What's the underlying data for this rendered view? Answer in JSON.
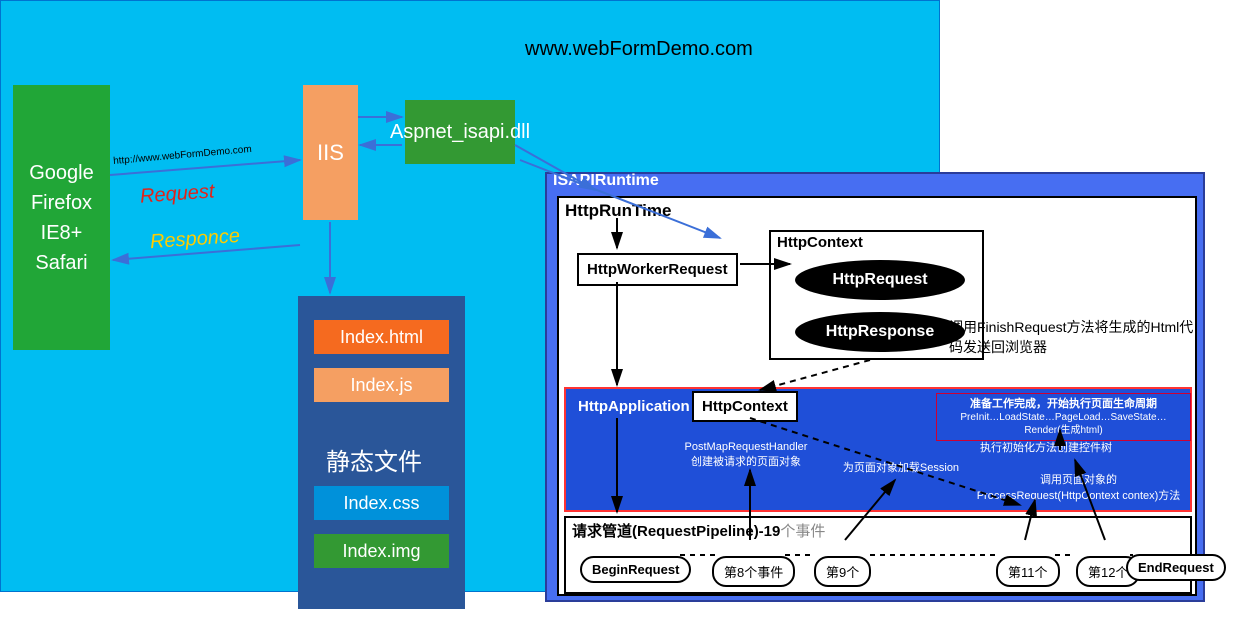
{
  "browsers": {
    "line1": "Google",
    "line2": "Firefox",
    "line3": "IE8+",
    "line4": "Safari"
  },
  "serverTitle": "www.webFormDemo.com",
  "iis": "IIS",
  "aspnet": "Aspnet_isapi.dll",
  "url": "http://www.webFormDemo.com",
  "request": "Request",
  "response": "Responce",
  "files": {
    "f1": "Index.html",
    "f2": "Index.js",
    "static": "静态文件",
    "f3": "Index.css",
    "f4": "Index.img"
  },
  "isapi": {
    "label": "ISAPIRuntime",
    "httpRuntime": "HttpRunTime",
    "httpWorkerRequest": "HttpWorkerRequest",
    "httpContext": "HttpContext",
    "httpRequest": "HttpRequest",
    "httpResponse": "HttpResponse",
    "finishText": "调用FinishRequest方法将生成的Html代码发送回浏览器",
    "httpApplication": "HttpApplication",
    "httpContext2": "HttpContext",
    "prepHeader": "准备工作完成，开始执行页面生命周期",
    "prepBody": "PreInit…LoadState…PageLoad…SaveState…Render(生成html)",
    "postMapL1": "PostMapRequestHandler",
    "postMapL2": "创建被请求的页面对象",
    "sessionTxt": "为页面对象加载Session",
    "initTxt": "执行初始化方法创建控件树",
    "procL1": "调用页面对象的",
    "procL2": "ProcessRequest(HttpContext contex)方法",
    "pipeline": "请求管道(RequestPipeline)-19",
    "pipelineSuffix": "个事件",
    "r1": "BeginRequest",
    "r2": "第8个事件",
    "r3": "第9个",
    "r4": "第11个",
    "r5": "第12个",
    "r6": "EndRequest"
  }
}
